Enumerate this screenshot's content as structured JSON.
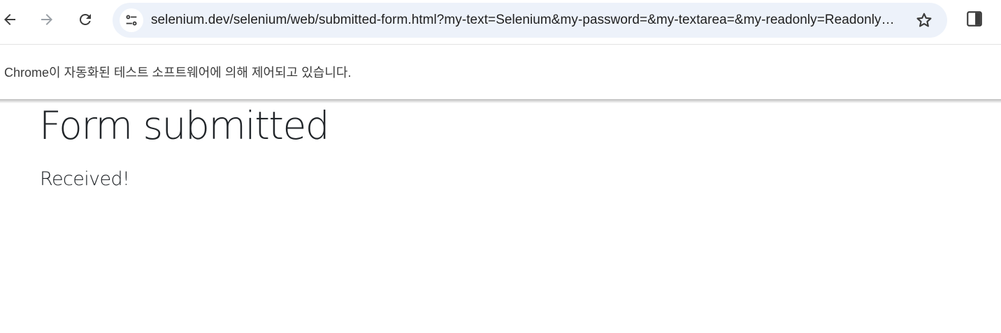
{
  "browser": {
    "address_bar": {
      "url": "selenium.dev/selenium/web/submitted-form.html?my-text=Selenium&my-password=&my-textarea=&my-readonly=Readonly+input&my-select=Open+this+select+menu&my-datalist=&my-date="
    },
    "infobar": {
      "message": "Chrome이 자동화된 테스트 소프트웨어에 의해 제어되고 있습니다."
    },
    "icons": {
      "back": "arrow-left-icon",
      "forward": "arrow-right-icon",
      "reload": "reload-icon",
      "site_info": "tune-icon",
      "bookmark": "star-icon",
      "side_panel": "side-panel-icon"
    },
    "colors": {
      "omnibox_bg": "#edf2fa",
      "text": "#1f1f1f",
      "disabled_icon": "#9aa0a6"
    }
  },
  "page": {
    "title": "Form submitted",
    "message": "Received!"
  }
}
